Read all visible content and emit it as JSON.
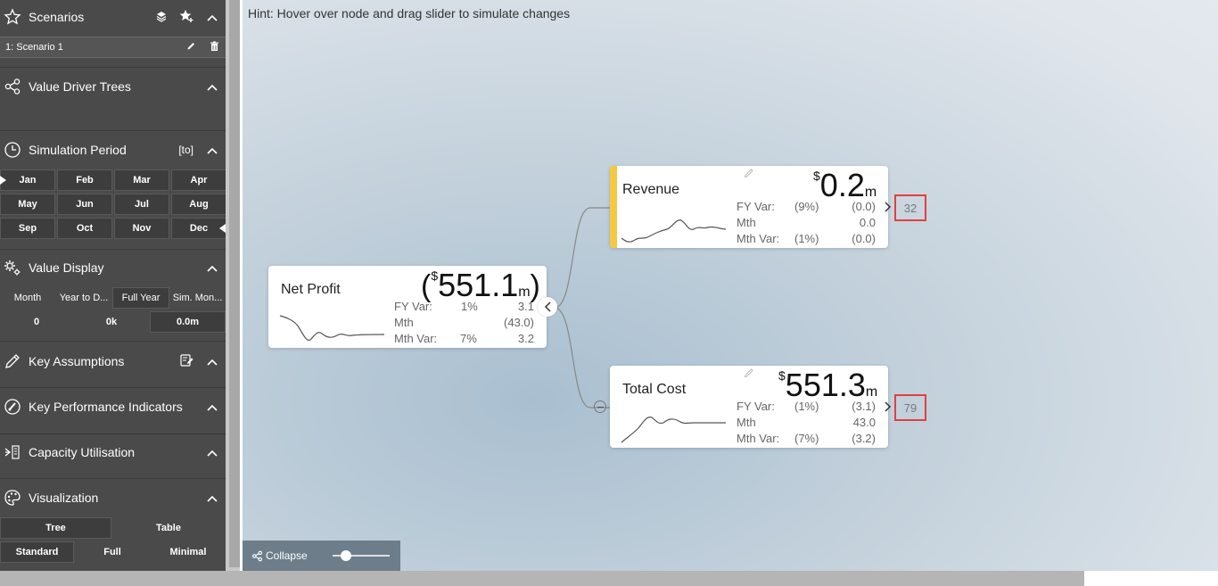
{
  "sidebar": {
    "scenarios": {
      "title": "Scenarios",
      "icon": "star-icon",
      "items": [
        {
          "label": "1: Scenario 1"
        }
      ]
    },
    "value_driver_trees": {
      "title": "Value Driver Trees",
      "icon": "share-icon"
    },
    "simulation_period": {
      "title": "Simulation Period",
      "extra": "[to]",
      "months": [
        "Jan",
        "Feb",
        "Mar",
        "Apr",
        "May",
        "Jun",
        "Jul",
        "Aug",
        "Sep",
        "Oct",
        "Nov",
        "Dec"
      ],
      "range_start": "Jan",
      "range_end": "Dec"
    },
    "value_display": {
      "title": "Value Display",
      "options": [
        "Month",
        "Year to D...",
        "Full Year",
        "Sim. Mon..."
      ],
      "selected": "Full Year",
      "values": [
        "0",
        "0k",
        "0.0m"
      ],
      "selected_value": "0.0m"
    },
    "key_assumptions": {
      "title": "Key Assumptions"
    },
    "kpis": {
      "title": "Key Performance Indicators"
    },
    "capacity": {
      "title": "Capacity Utilisation"
    },
    "visualization": {
      "title": "Visualization",
      "modes": [
        "Tree",
        "Table"
      ],
      "selected_mode": "Tree",
      "sizes": [
        "Standard",
        "Full",
        "Minimal"
      ],
      "selected_size": "Standard"
    }
  },
  "canvas": {
    "hint": "Hint: Hover over node and drag slider to simulate changes",
    "bottom_bar": {
      "collapse_label": "Collapse",
      "zoom_level": 0.18
    }
  },
  "nodes": {
    "net_profit": {
      "label": "Net Profit",
      "open_paren": "(",
      "currency": "$",
      "value": "551.1",
      "unit": "m",
      "close_paren": ")",
      "fy_var_label": "FY Var:",
      "fy_var_pct": "1%",
      "fy_var_val": "3.1",
      "mth_label": "Mth",
      "mth_val": "(43.0)",
      "mth_var_label": "Mth Var:",
      "mth_var_pct": "7%",
      "mth_var_val": "3.2"
    },
    "revenue": {
      "label": "Revenue",
      "currency": "$",
      "value": "0.2",
      "unit": "m",
      "fy_var_label": "FY Var:",
      "fy_var_pct": "(9%)",
      "fy_var_val": "(0.0)",
      "mth_label": "Mth",
      "mth_val": "0.0",
      "mth_var_label": "Mth Var:",
      "mth_var_pct": "(1%)",
      "mth_var_val": "(0.0)",
      "kpi": "32",
      "accent_color": "#f5c842"
    },
    "total_cost": {
      "label": "Total Cost",
      "currency": "$",
      "value": "551.3",
      "unit": "m",
      "fy_var_label": "FY Var:",
      "fy_var_pct": "(1%)",
      "fy_var_val": "(3.1)",
      "mth_label": "Mth",
      "mth_val": "43.0",
      "mth_var_label": "Mth Var:",
      "mth_var_pct": "(7%)",
      "mth_var_val": "(3.2)",
      "kpi": "79"
    }
  }
}
